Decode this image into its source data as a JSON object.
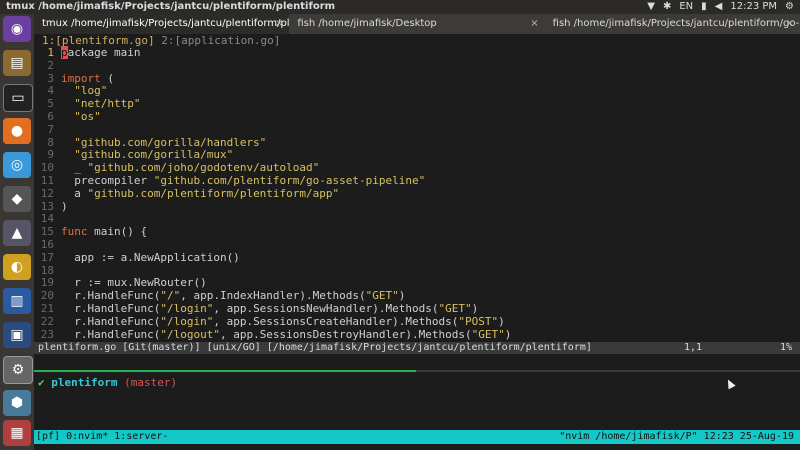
{
  "topbar": {
    "title": "tmux /home/jimafisk/Projects/jantcu/plentiform/plentiform",
    "lang": "EN",
    "time": "12:23 PM"
  },
  "tabs": [
    {
      "label": "tmux /home/jimafisk/Projects/jantcu/plentiform/pl...",
      "close": "×"
    },
    {
      "label": "fish /home/jimafisk/Desktop",
      "close": "×"
    },
    {
      "label": "fish /home/jimafisk/Projects/jantcu/plentiform/go-i...",
      "close": "×"
    }
  ],
  "editor": {
    "buftab_current": "1:[plentiform.go]",
    "buftab_other": "2:[application.go]",
    "lines": [
      {
        "n": "1",
        "text": "package main"
      },
      {
        "n": "2",
        "text": ""
      },
      {
        "n": "3",
        "text": "import ("
      },
      {
        "n": "4",
        "text": "  \"log\""
      },
      {
        "n": "5",
        "text": "  \"net/http\""
      },
      {
        "n": "6",
        "text": "  \"os\""
      },
      {
        "n": "7",
        "text": ""
      },
      {
        "n": "8",
        "text": "  \"github.com/gorilla/handlers\""
      },
      {
        "n": "9",
        "text": "  \"github.com/gorilla/mux\""
      },
      {
        "n": "10",
        "text": "  _ \"github.com/joho/godotenv/autoload\""
      },
      {
        "n": "11",
        "text": "  precompiler \"github.com/plentiform/go-asset-pipeline\""
      },
      {
        "n": "12",
        "text": "  a \"github.com/plentiform/plentiform/app\""
      },
      {
        "n": "13",
        "text": ")"
      },
      {
        "n": "14",
        "text": ""
      },
      {
        "n": "15",
        "text": "func main() {"
      },
      {
        "n": "16",
        "text": ""
      },
      {
        "n": "17",
        "text": "  app := a.NewApplication()"
      },
      {
        "n": "18",
        "text": ""
      },
      {
        "n": "19",
        "text": "  r := mux.NewRouter()"
      },
      {
        "n": "20",
        "text": "  r.HandleFunc(\"/\", app.IndexHandler).Methods(\"GET\")"
      },
      {
        "n": "21",
        "text": "  r.HandleFunc(\"/login\", app.SessionsNewHandler).Methods(\"GET\")"
      },
      {
        "n": "22",
        "text": "  r.HandleFunc(\"/login\", app.SessionsCreateHandler).Methods(\"POST\")"
      },
      {
        "n": "23",
        "text": "  r.HandleFunc(\"/logout\", app.SessionsDestroyHandler).Methods(\"GET\")"
      }
    ]
  },
  "statusline": {
    "left": "plentiform.go [Git(master)] [unix/GO] [/home/jimafisk/Projects/jantcu/plentiform/plentiform]",
    "position": "1,1",
    "percent": "1%"
  },
  "shell": {
    "check": "✔",
    "project": "plentiform",
    "branch": "(master)"
  },
  "tmux": {
    "session": "[pf]",
    "window0": "0:nvim*",
    "window1": "1:server-",
    "right": "\"nvim /home/jimafisk/P\" 12:23 25-Aug-19"
  }
}
